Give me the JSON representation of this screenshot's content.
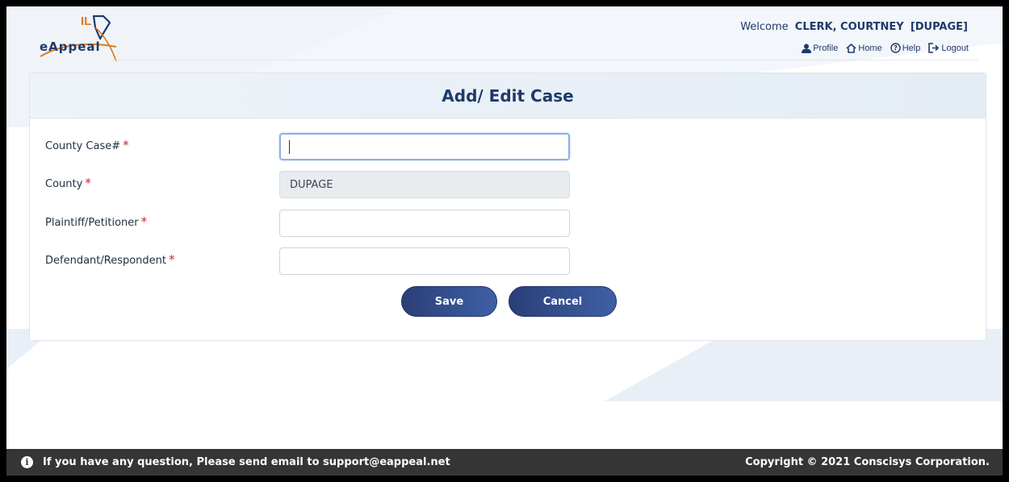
{
  "header": {
    "logo_mark": "IL",
    "logo_text": "eAppeal",
    "welcome_label": "Welcome",
    "user": "CLERK, COURTNEY",
    "county_tag": "[DUPAGE]",
    "links": {
      "profile": "Profile",
      "home": "Home",
      "help": "Help",
      "logout": "Logout"
    }
  },
  "card": {
    "title": "Add/ Edit Case"
  },
  "form": {
    "county_case": {
      "label": "County Case#",
      "required": "*",
      "value": ""
    },
    "county": {
      "label": "County",
      "required": "*",
      "value": "DUPAGE"
    },
    "plaintiff": {
      "label": "Plaintiff/Petitioner",
      "required": "*",
      "value": ""
    },
    "defendant": {
      "label": "Defendant/Respondent",
      "required": "*",
      "value": ""
    }
  },
  "buttons": {
    "save": "Save",
    "cancel": "Cancel"
  },
  "footer": {
    "message": "If you have any question, Please send email to support@eappeal.net",
    "copyright": "Copyright © 2021 Conscisys Corporation."
  },
  "colors": {
    "brand_navy": "#1e3a6b",
    "brand_orange": "#e07a1f",
    "required_red": "#d0202e",
    "footer_bg": "#353535"
  }
}
